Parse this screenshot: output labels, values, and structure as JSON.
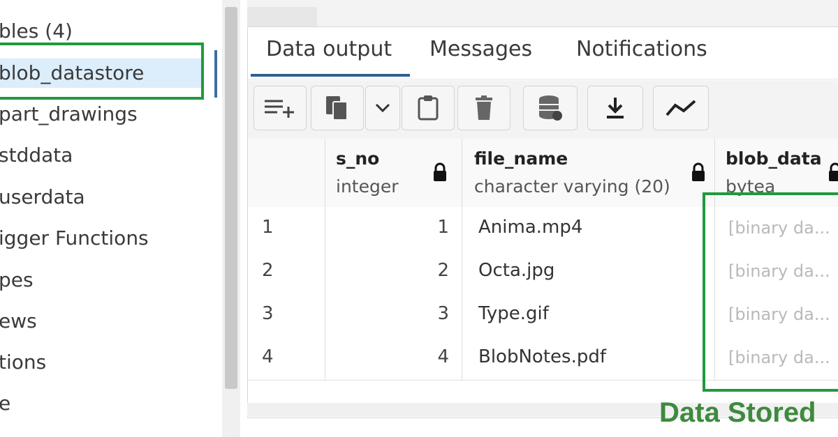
{
  "sidebar": {
    "items": [
      {
        "label": "bles (4)"
      },
      {
        "label": "blob_datastore"
      },
      {
        "label": "part_drawings"
      },
      {
        "label": "stddata"
      },
      {
        "label": "userdata"
      },
      {
        "label": "igger Functions"
      },
      {
        "label": "pes"
      },
      {
        "label": "ews"
      },
      {
        "label": "tions"
      },
      {
        "label": "e"
      }
    ],
    "selected_index": 1
  },
  "tabs": [
    {
      "label": "Data output",
      "active": true
    },
    {
      "label": "Messages",
      "active": false
    },
    {
      "label": "Notifications",
      "active": false
    }
  ],
  "toolbar": {
    "buttons": [
      "add-row-icon",
      "copy-icon",
      "chevron-down-icon",
      "paste-icon",
      "delete-icon",
      "save-data-icon",
      "download-icon",
      "graph-icon"
    ]
  },
  "grid": {
    "columns": [
      {
        "name": "s_no",
        "type": "integer"
      },
      {
        "name": "file_name",
        "type": "character varying (20)"
      },
      {
        "name": "blob_data",
        "type": "bytea"
      }
    ],
    "rows": [
      {
        "row_num": "1",
        "s_no": "1",
        "file_name": "Anima.mp4",
        "blob_data": "[binary da..."
      },
      {
        "row_num": "2",
        "s_no": "2",
        "file_name": "Octa.jpg",
        "blob_data": "[binary da..."
      },
      {
        "row_num": "3",
        "s_no": "3",
        "file_name": "Type.gif",
        "blob_data": "[binary da..."
      },
      {
        "row_num": "4",
        "s_no": "4",
        "file_name": "BlobNotes.pdf",
        "blob_data": "[binary da..."
      }
    ]
  },
  "annotation": {
    "caption": "Data Stored",
    "highlight_color": "#1f9a3c"
  }
}
